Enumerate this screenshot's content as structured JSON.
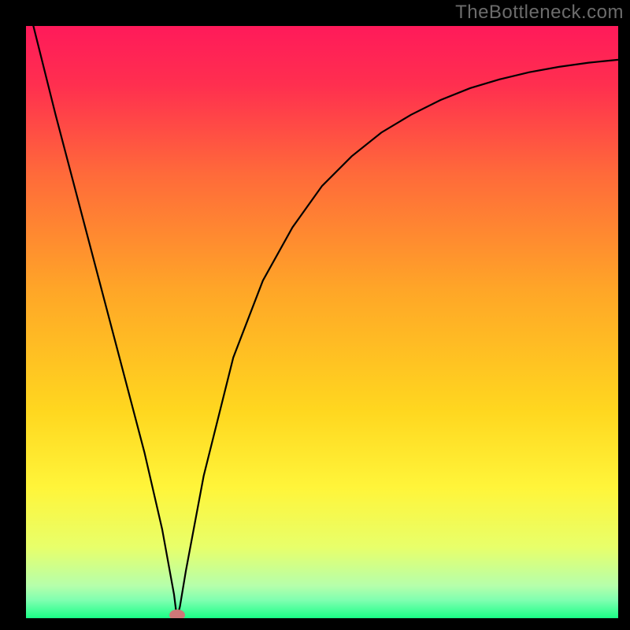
{
  "watermark": "TheBottleneck.com",
  "chart_data": {
    "type": "line",
    "title": "",
    "xlabel": "",
    "ylabel": "",
    "xlim": [
      0,
      100
    ],
    "ylim": [
      0,
      100
    ],
    "gradient_stops": [
      {
        "pos": 0.0,
        "color": "#ff1a5a"
      },
      {
        "pos": 0.1,
        "color": "#ff2f4f"
      },
      {
        "pos": 0.25,
        "color": "#ff6a3a"
      },
      {
        "pos": 0.45,
        "color": "#ffa727"
      },
      {
        "pos": 0.65,
        "color": "#ffd71f"
      },
      {
        "pos": 0.78,
        "color": "#fff53a"
      },
      {
        "pos": 0.88,
        "color": "#e8ff6a"
      },
      {
        "pos": 0.945,
        "color": "#b6ffab"
      },
      {
        "pos": 0.97,
        "color": "#7effb0"
      },
      {
        "pos": 1.0,
        "color": "#1aff86"
      }
    ],
    "series": [
      {
        "name": "curve",
        "x": [
          0,
          2,
          5,
          10,
          15,
          20,
          23,
          25,
          25.5,
          26,
          27,
          30,
          35,
          40,
          45,
          50,
          55,
          60,
          65,
          70,
          75,
          80,
          85,
          90,
          95,
          100
        ],
        "y": [
          105,
          97,
          85,
          66,
          47,
          28,
          15,
          4,
          0,
          2,
          8,
          24,
          44,
          57,
          66,
          73,
          78,
          82,
          85,
          87.5,
          89.5,
          91,
          92.2,
          93.1,
          93.8,
          94.3
        ]
      }
    ],
    "marker": {
      "x": 25.5,
      "y": 0.5
    },
    "colors": {
      "curve": "#000000",
      "marker": "#cf7878",
      "background": "#000000",
      "watermark": "#6c6c6c"
    }
  }
}
